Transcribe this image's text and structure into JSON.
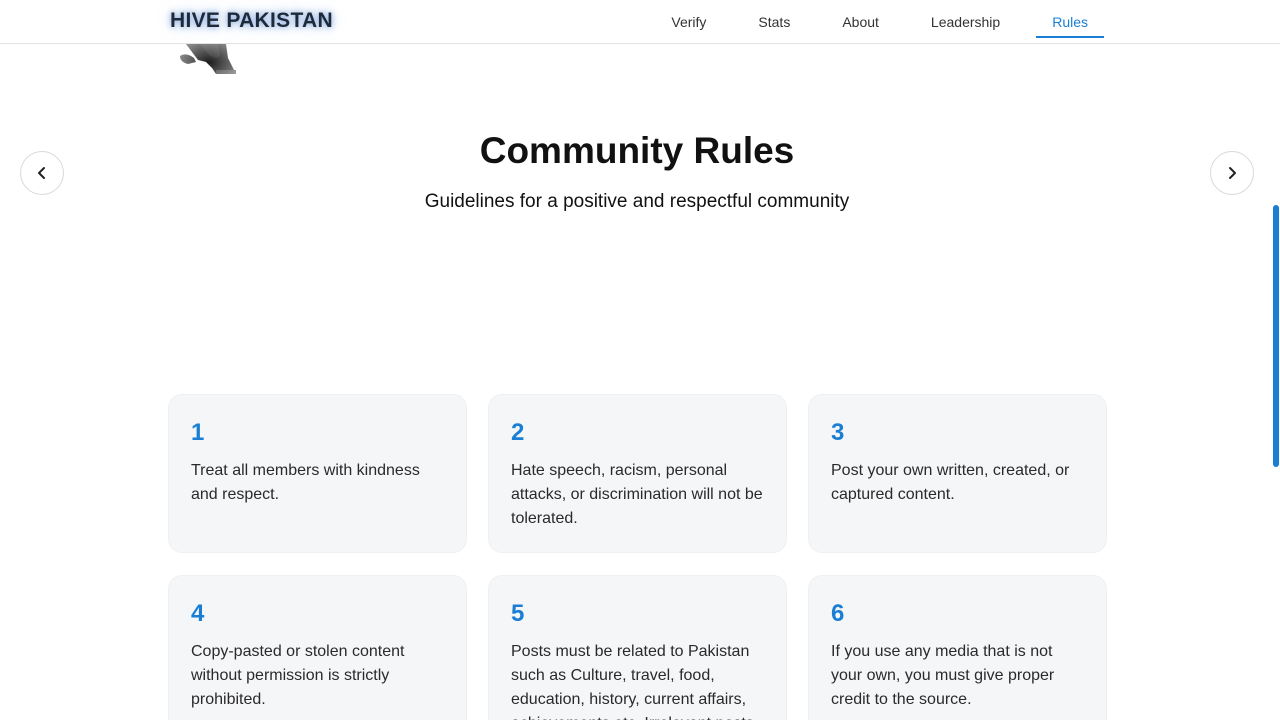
{
  "header": {
    "brand": "HIVE PAKISTAN",
    "nav": [
      {
        "label": "Verify",
        "active": false
      },
      {
        "label": "Stats",
        "active": false
      },
      {
        "label": "About",
        "active": false
      },
      {
        "label": "Leadership",
        "active": false
      },
      {
        "label": "Rules",
        "active": true
      }
    ]
  },
  "colors": {
    "accent": "#1a7fd4",
    "card_background": "#f5f6f8",
    "heading": "#111111"
  },
  "icons": {
    "previous": "chevron-left-icon",
    "next": "chevron-right-icon"
  },
  "section": {
    "title": "Community Rules",
    "subtitle": "Guidelines for a positive and respectful community"
  },
  "rules": [
    {
      "number": "1",
      "text": "Treat all members with kindness and respect."
    },
    {
      "number": "2",
      "text": "Hate speech, racism, personal attacks, or discrimination will not be tolerated."
    },
    {
      "number": "3",
      "text": "Post your own written, created, or captured content."
    },
    {
      "number": "4",
      "text": "Copy-pasted or stolen content without permission is strictly prohibited."
    },
    {
      "number": "5",
      "text": "Posts must be related to Pakistan such as Culture, travel, food, education, history, current affairs, achievements etc. Irrelevant posts"
    },
    {
      "number": "6",
      "text": "If you use any media that is not your own, you must give proper credit to the source."
    }
  ]
}
